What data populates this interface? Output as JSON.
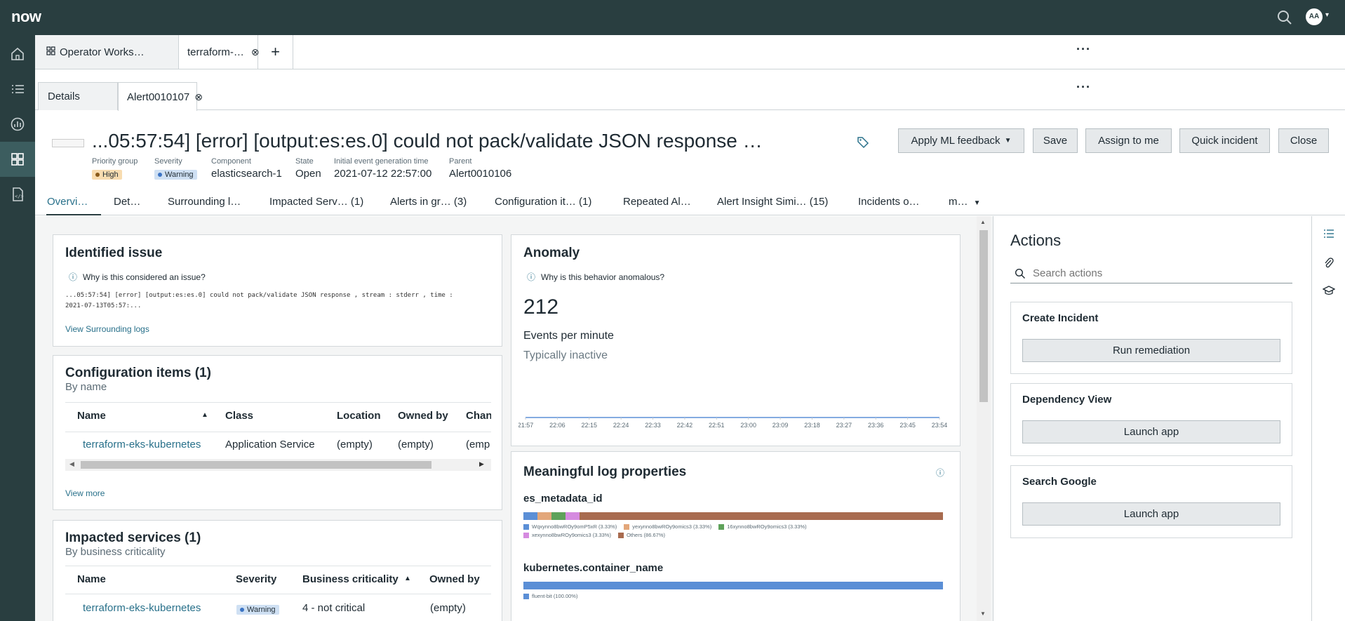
{
  "top": {
    "logo": "now",
    "avatar_initials": "AA"
  },
  "workspace_tabs": [
    {
      "label": "Operator Works…"
    },
    {
      "label": "terraform-…"
    }
  ],
  "sub_tabs": [
    {
      "label": "Details"
    },
    {
      "label": "Alert0010107"
    }
  ],
  "header": {
    "title": "...05:57:54] [error] [output:es:es.0] could not pack/validate JSON response …",
    "buttons": {
      "ml_feedback": "Apply ML feedback",
      "save": "Save",
      "assign": "Assign to me",
      "quick_incident": "Quick incident",
      "close": "Close"
    },
    "meta": {
      "priority_label": "Priority group",
      "priority_value": "High",
      "severity_label": "Severity",
      "severity_value": "Warning",
      "component_label": "Component",
      "component_value": "elasticsearch-1",
      "state_label": "State",
      "state_value": "Open",
      "initial_time_label": "Initial event generation time",
      "initial_time_value": "2021-07-12 22:57:00",
      "parent_label": "Parent",
      "parent_value": "Alert0010106"
    }
  },
  "content_tabs": [
    "Overvi…",
    "Det…",
    "Surrounding l…",
    "Impacted Serv… (1)",
    "Alerts in gr… (3)",
    "Configuration it… (1)",
    "Repeated Al…",
    "Alert Insight Simi… (15)",
    "Incidents o…",
    "m…"
  ],
  "identified_issue": {
    "title": "Identified issue",
    "why": "Why is this considered an issue?",
    "log_line1": "...05:57:54] [error] [output:es:es.0] could not pack/validate JSON response , stream : stderr , time :",
    "log_line2": "2021-07-13T05:57:...",
    "link": "View Surrounding logs"
  },
  "config_items": {
    "title": "Configuration items (1)",
    "subtitle": "By name",
    "columns": [
      "Name",
      "Class",
      "Location",
      "Owned by",
      "Chan"
    ],
    "rows": [
      [
        "terraform-eks-kubernetes",
        "Application Service",
        "(empty)",
        "(empty)",
        "(emp"
      ]
    ],
    "view_more": "View more"
  },
  "impacted_services": {
    "title": "Impacted services (1)",
    "subtitle": "By business criticality",
    "columns": [
      "Name",
      "Severity",
      "Business criticality",
      "Owned by"
    ],
    "rows": [
      [
        "terraform-eks-kubernetes",
        "Warning",
        "4 - not critical",
        "(empty)"
      ]
    ]
  },
  "anomaly": {
    "title": "Anomaly",
    "why": "Why is this behavior anomalous?",
    "value": "212",
    "unit": "Events per minute",
    "status": "Typically inactive",
    "chart_data": {
      "type": "line",
      "x": [
        "21:57",
        "22:06",
        "22:15",
        "22:24",
        "22:33",
        "22:42",
        "22:51",
        "23:00",
        "23:09",
        "23:18",
        "23:27",
        "23:36",
        "23:45",
        "23:54"
      ],
      "series": [
        {
          "values": [
            0,
            0,
            0,
            0,
            0,
            0,
            0,
            0,
            0,
            0,
            0,
            0,
            0,
            0
          ]
        }
      ],
      "xlabel": "",
      "ylabel": ""
    }
  },
  "log_properties": {
    "title": "Meaningful log properties",
    "props": [
      {
        "name": "es_metadata_id",
        "segments": [
          {
            "label": "Wqxynno8bwROy9omP5xR (3.33%)",
            "pct": 3.33,
            "color": "#5b8fd6"
          },
          {
            "label": "yexynno8bwROy9omics3 (3.33%)",
            "pct": 3.33,
            "color": "#e3a77a"
          },
          {
            "label": "16xynno8bwROy9omics3 (3.33%)",
            "pct": 3.33,
            "color": "#5ea25a"
          },
          {
            "label": "xexynno8bwROy9omics3 (3.33%)",
            "pct": 3.33,
            "color": "#d58be0"
          },
          {
            "label": "Others (86.67%)",
            "pct": 86.67,
            "color": "#a86b4f"
          }
        ]
      },
      {
        "name": "kubernetes.container_name",
        "segments": [
          {
            "label": "fluent-bit (100.00%)",
            "pct": 100,
            "color": "#5b8fd6"
          }
        ]
      }
    ]
  },
  "actions": {
    "title": "Actions",
    "search_placeholder": "Search actions",
    "cards": [
      {
        "title": "Create Incident",
        "button": "Run remediation"
      },
      {
        "title": "Dependency View",
        "button": "Launch app"
      },
      {
        "title": "Search Google",
        "button": "Launch app"
      }
    ]
  },
  "colors": {
    "nav_bg": "#293e40",
    "link": "#28708a",
    "high": "#f8dcb0",
    "warning": "#cfe0f3"
  }
}
